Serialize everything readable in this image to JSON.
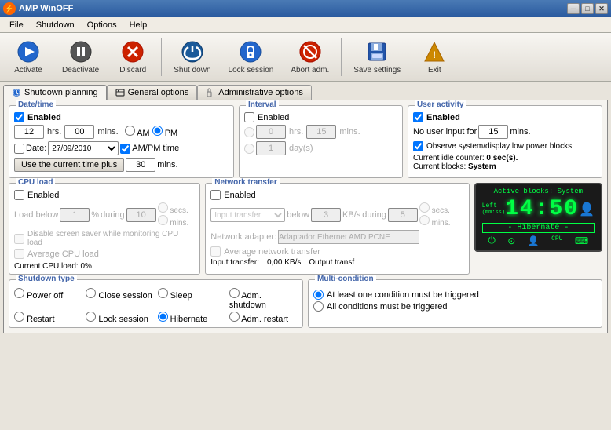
{
  "titlebar": {
    "title": "AMP WinOFF",
    "icon": "⚡"
  },
  "titlebar_controls": {
    "minimize": "─",
    "maximize": "□",
    "close": "✕"
  },
  "menu": {
    "items": [
      "File",
      "Shutdown",
      "Options",
      "Help"
    ]
  },
  "toolbar": {
    "buttons": [
      {
        "id": "activate",
        "label": "Activate",
        "icon": "▶"
      },
      {
        "id": "deactivate",
        "label": "Deactivate",
        "icon": "⏸"
      },
      {
        "id": "discard",
        "label": "Discard",
        "icon": "✖"
      },
      {
        "id": "shutdown",
        "label": "Shut down",
        "icon": "⏻"
      },
      {
        "id": "lock",
        "label": "Lock session",
        "icon": "🔒"
      },
      {
        "id": "abort",
        "label": "Abort adm.",
        "icon": "🚫"
      },
      {
        "id": "save",
        "label": "Save settings",
        "icon": "💾"
      },
      {
        "id": "exit",
        "label": "Exit",
        "icon": "🚪"
      }
    ]
  },
  "tabs": [
    {
      "id": "shutdown-planning",
      "label": "Shutdown planning",
      "active": true
    },
    {
      "id": "general-options",
      "label": "General options",
      "active": false
    },
    {
      "id": "admin-options",
      "label": "Administrative options",
      "active": false
    }
  ],
  "date_time": {
    "section_label": "Date/time",
    "enabled": true,
    "enabled_label": "Enabled",
    "hours": "12",
    "mins": "00",
    "mins_label": "mins.",
    "hrs_label": "hrs.",
    "am": "AM",
    "pm": "PM",
    "pm_selected": true,
    "date_label": "Date:",
    "date_value": "27/09/2010",
    "ampm_time_label": "AM/PM time",
    "use_current_btn": "Use the current time plus",
    "offset_mins": "30",
    "offset_mins_label": "mins."
  },
  "interval": {
    "section_label": "Interval",
    "enabled": false,
    "enabled_label": "Enabled",
    "hours": "0",
    "mins": "15",
    "mins_label": "mins.",
    "hrs_label": "hrs.",
    "days": "1",
    "day_label": "day(s)"
  },
  "user_activity": {
    "section_label": "User activity",
    "enabled": true,
    "enabled_label": "Enabled",
    "no_user_input_label": "No user input for",
    "mins_value": "15",
    "mins_label": "mins.",
    "observe_label": "Observe system/display low power blocks",
    "current_idle_label": "Current idle counter:",
    "current_idle_value": "0 sec(s).",
    "current_blocks_label": "Current blocks:",
    "current_blocks_value": "System"
  },
  "cpu_load": {
    "section_label": "CPU load",
    "enabled": false,
    "enabled_label": "Enabled",
    "load_below_label": "Load below",
    "load_value": "1",
    "percent_label": "%",
    "during_label": "during",
    "during_value": "10",
    "secs_label": "secs.",
    "mins_label": "mins.",
    "disable_screensaver_label": "Disable screen saver while monitoring CPU load",
    "average_cpu_label": "Average CPU load",
    "current_load_label": "Current CPU load:",
    "current_load_value": "0%"
  },
  "network_transfer": {
    "section_label": "Network transfer",
    "enabled": false,
    "enabled_label": "Enabled",
    "input_transfer_label": "Input transfer",
    "below_label": "below",
    "kb_value": "3",
    "kb_label": "KB/s",
    "during_label": "during",
    "during_value": "5",
    "secs_label": "secs.",
    "mins_label": "mins.",
    "adapter_label": "Network adapter:",
    "adapter_value": "Adaptador Ethernet AMD PCNE",
    "average_network_label": "Average network transfer",
    "input_transfer_val_label": "Input transfer:",
    "input_transfer_val": "0,00 KB/s",
    "output_transfer_label": "Output transf"
  },
  "led": {
    "title": "Active blocks: System",
    "left_label": "Left",
    "left_unit": "(mm:ss)",
    "time": "14:50",
    "mode": "- Hibernate -",
    "icons": [
      "⏻",
      "⊙",
      "👤",
      "CPU",
      "⌨"
    ]
  },
  "shutdown_type": {
    "section_label": "Shutdown type",
    "options": [
      {
        "id": "power-off",
        "label": "Power off",
        "checked": true
      },
      {
        "id": "close-session",
        "label": "Close session",
        "checked": false
      },
      {
        "id": "sleep",
        "label": "Sleep",
        "checked": false
      },
      {
        "id": "adm-shutdown",
        "label": "Adm. shutdown",
        "checked": false
      },
      {
        "id": "restart",
        "label": "Restart",
        "checked": false
      },
      {
        "id": "lock-session",
        "label": "Lock session",
        "checked": false
      },
      {
        "id": "hibernate",
        "label": "Hibernate",
        "checked": true
      },
      {
        "id": "adm-restart",
        "label": "Adm. restart",
        "checked": false
      }
    ]
  },
  "multi_condition": {
    "section_label": "Multi-condition",
    "options": [
      {
        "id": "at-least-one",
        "label": "At least one condition must be triggered",
        "checked": true
      },
      {
        "id": "all-conditions",
        "label": "All conditions must be triggered",
        "checked": false
      }
    ]
  }
}
